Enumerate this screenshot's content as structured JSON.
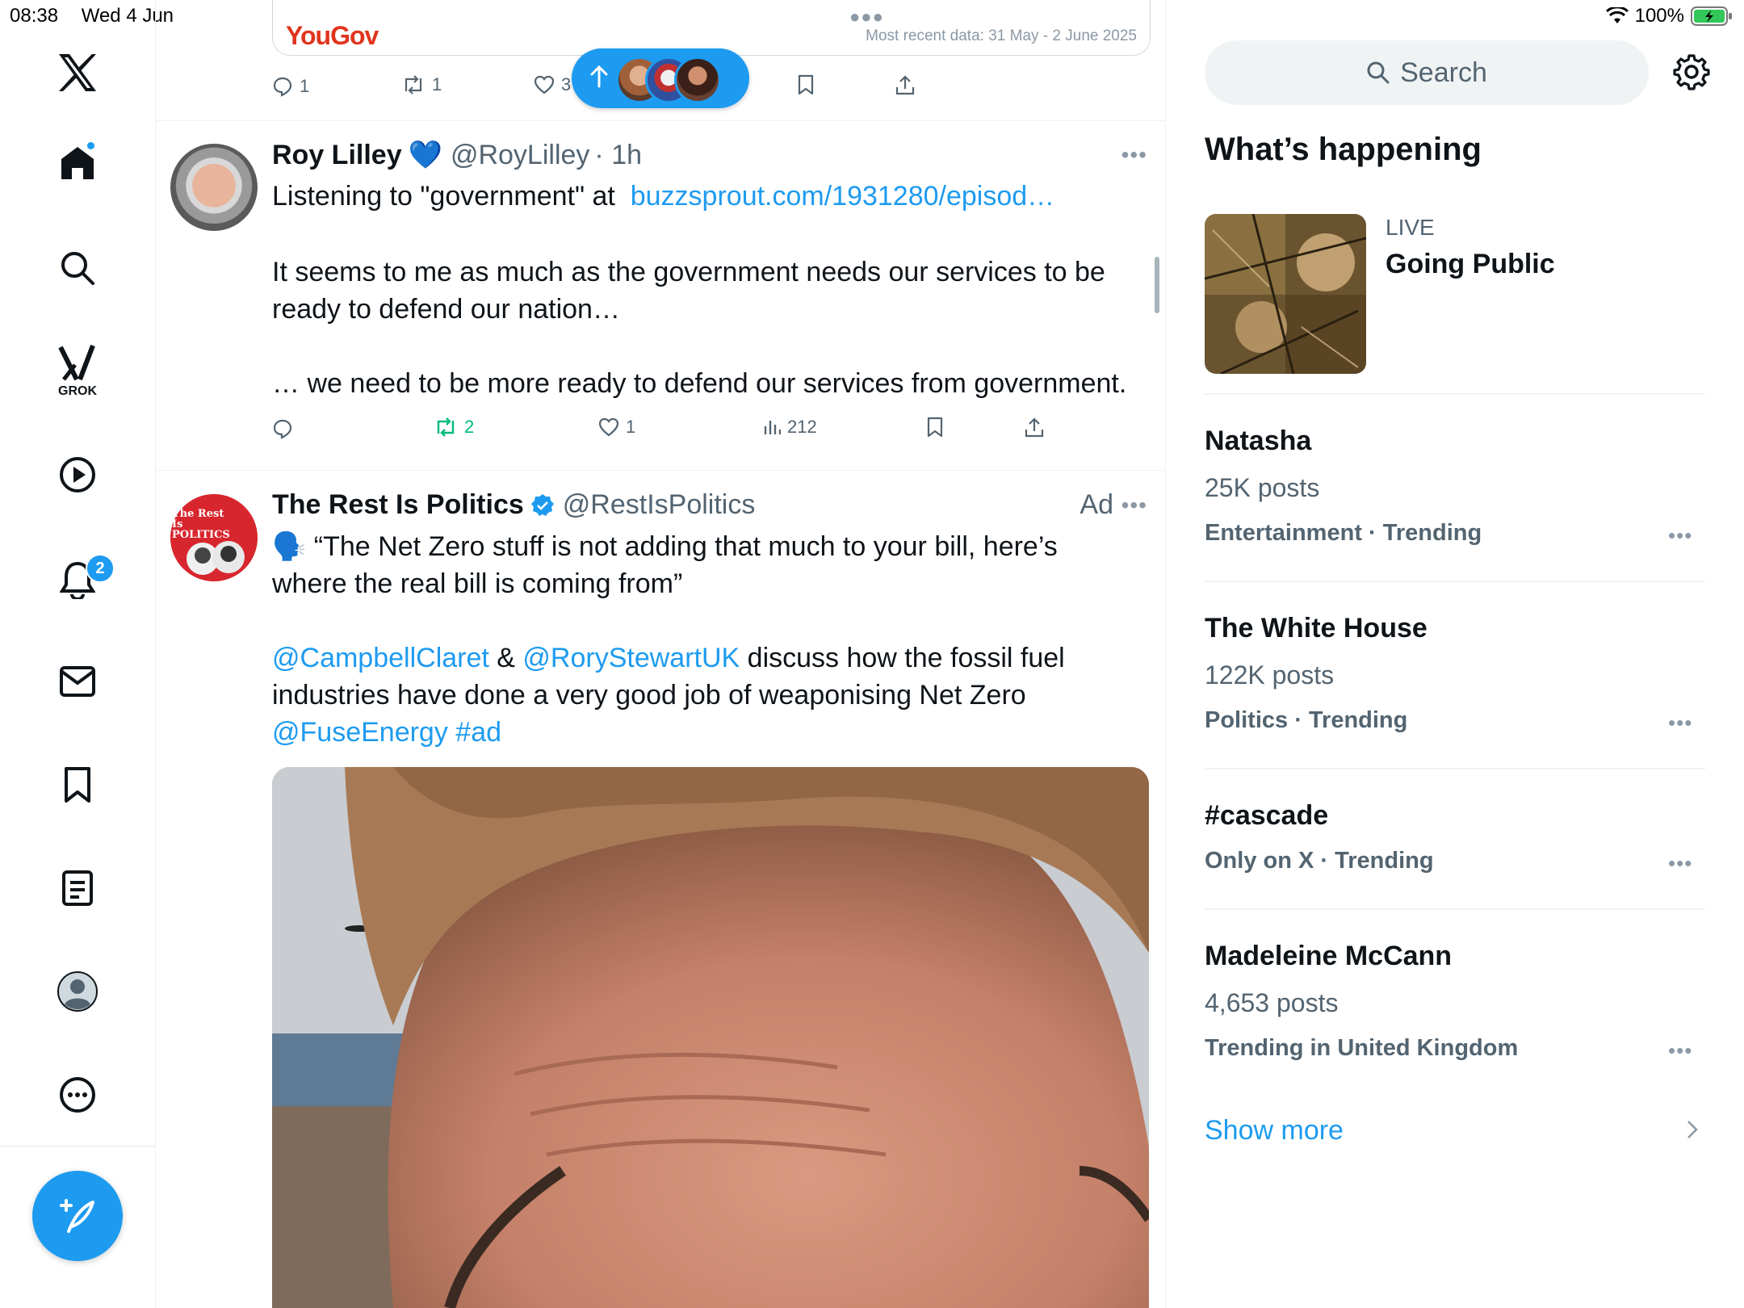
{
  "status_bar": {
    "time": "08:38",
    "date": "Wed 4 Jun",
    "battery": "100%",
    "icons": [
      "wifi-icon",
      "battery-charging-icon"
    ]
  },
  "nav": {
    "items": [
      {
        "name": "x-logo-icon"
      },
      {
        "name": "home-icon"
      },
      {
        "name": "search-icon"
      },
      {
        "name": "grok-icon",
        "label": "GROK"
      },
      {
        "name": "video-icon"
      },
      {
        "name": "notifications-icon",
        "badge": "2"
      },
      {
        "name": "messages-icon"
      },
      {
        "name": "bookmarks-icon"
      },
      {
        "name": "lists-icon"
      },
      {
        "name": "profile-icon"
      },
      {
        "name": "more-icon"
      }
    ],
    "compose": "compose-post-icon"
  },
  "top_card": {
    "brand": "YouGov",
    "meta": "Most recent data: 31 May - 2 June 2025",
    "replies": "1",
    "reposts": "1",
    "likes": "3"
  },
  "tweet1": {
    "name": "Roy Lilley",
    "emoji": "💙",
    "handle": "@RoyLilley",
    "time": "· 1h",
    "text_prefix": "Listening to \"government\" at  ",
    "link": "buzzsprout.com/1931280/episod…",
    "para2": "It seems to me as much as the government needs our services to be ready to defend our nation…",
    "para3": "… we need to be more ready to defend our services from government.",
    "reposts": "2",
    "likes": "1",
    "views": "212"
  },
  "tweet2": {
    "name": "The Rest Is Politics",
    "handle": "@RestIsPolitics",
    "ad": "Ad",
    "avatar_text": "The Rest Is POLITICS",
    "line1": "🗣️ “The Net Zero stuff is not adding that much to your bill, here’s where the real bill is coming from”",
    "mention1": "@CampbellClaret",
    "amp": " & ",
    "mention2": "@RoryStewartUK",
    "rest": " discuss how the fossil fuel industries have done a very good job of weaponising Net Zero",
    "mention3": "@FuseEnergy",
    "hashtag": "#ad"
  },
  "sidebar": {
    "search_placeholder": "Search",
    "section_title": "What’s happening",
    "live": {
      "tag": "LIVE",
      "title": "Going Public"
    },
    "trends": [
      {
        "title": "Natasha",
        "posts": "25K posts",
        "meta": "Entertainment · Trending"
      },
      {
        "title": "The White House",
        "posts": "122K posts",
        "meta": "Politics · Trending"
      },
      {
        "title": "#cascade",
        "posts": "",
        "meta": "Only on X · Trending"
      },
      {
        "title": "Madeleine McCann",
        "posts": "4,653 posts",
        "meta": "Trending in United Kingdom"
      }
    ],
    "show_more": "Show more"
  },
  "colors": {
    "accent": "#1d9bf0",
    "repost_active": "#00ba7c",
    "yougov": "#e0351e"
  }
}
